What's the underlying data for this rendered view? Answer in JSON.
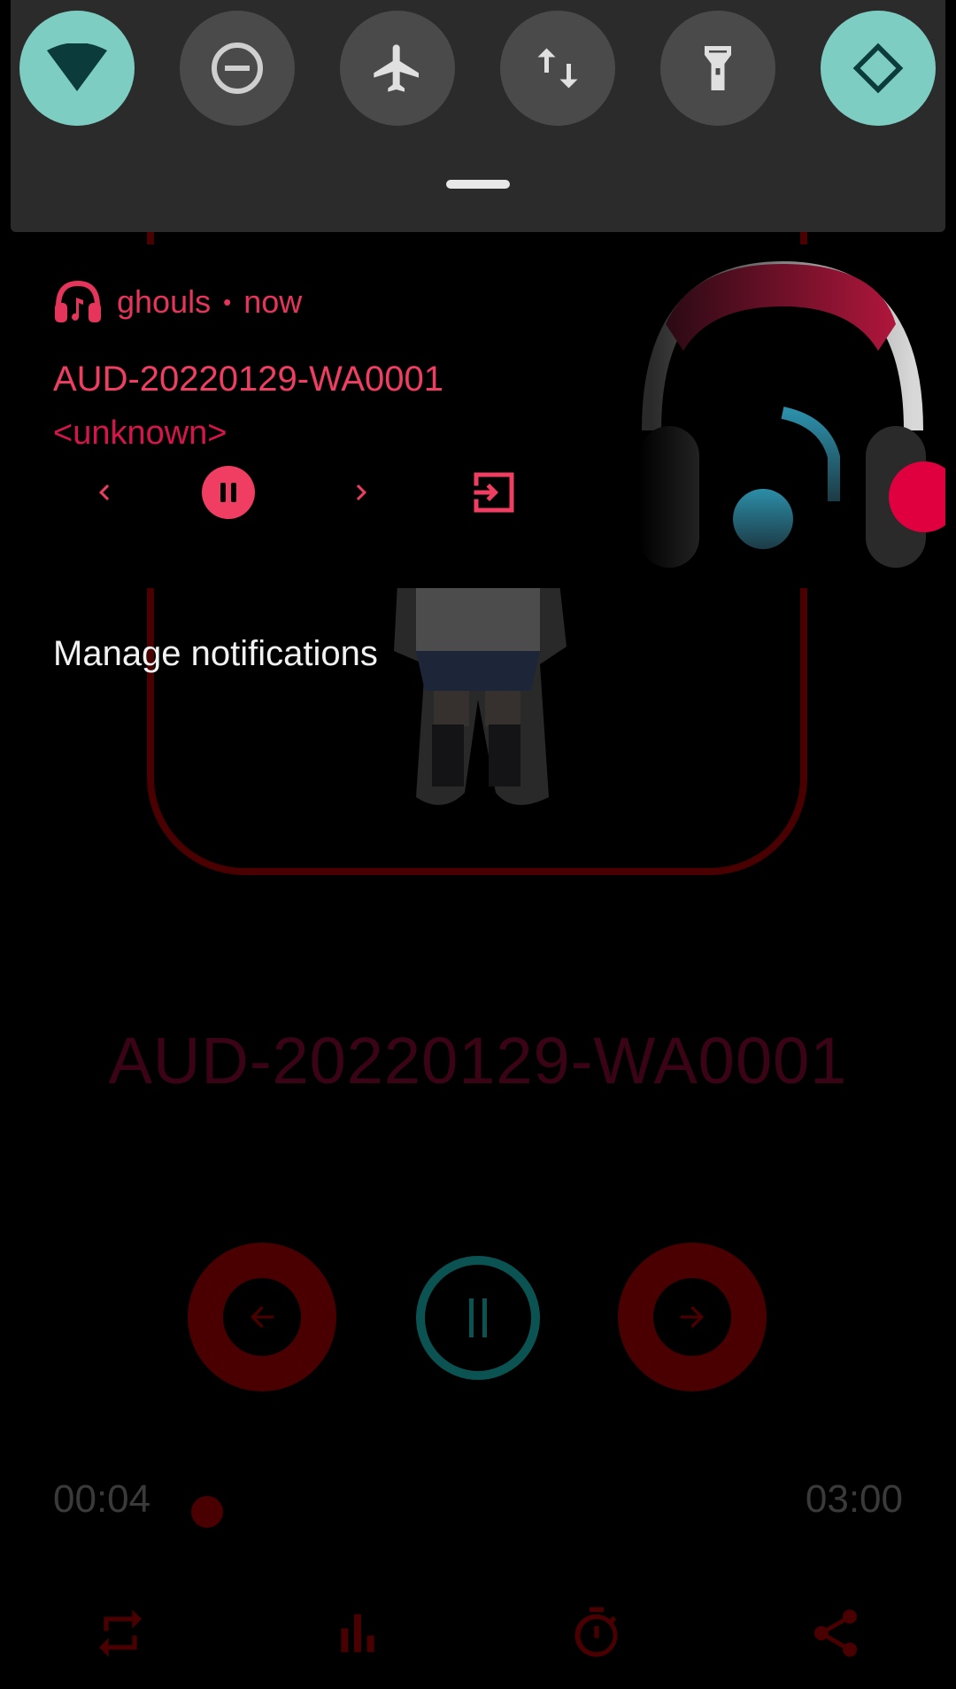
{
  "quick_settings": {
    "tiles": [
      {
        "name": "wifi",
        "icon": "wifi-icon",
        "on": true
      },
      {
        "name": "dnd",
        "icon": "do-not-disturb-icon",
        "on": false
      },
      {
        "name": "airplane",
        "icon": "airplane-icon",
        "on": false
      },
      {
        "name": "data",
        "icon": "mobile-data-icon",
        "on": false
      },
      {
        "name": "flashlight",
        "icon": "flashlight-icon",
        "on": false
      },
      {
        "name": "rotate",
        "icon": "auto-rotate-icon",
        "on": true
      }
    ],
    "colors": {
      "on": "#7ecdc2",
      "off": "#4a4a4a"
    }
  },
  "notification": {
    "app_name": "ghouls",
    "separator": "•",
    "time": "now",
    "title": "AUD-20220129-WA0001",
    "artist": "<unknown>",
    "accent": "#e6355b"
  },
  "manage_label": "Manage notifications",
  "player": {
    "title": "AUD-20220129-WA0001",
    "current_time": "00:04",
    "total_time": "03:00",
    "progress": 0.022
  }
}
